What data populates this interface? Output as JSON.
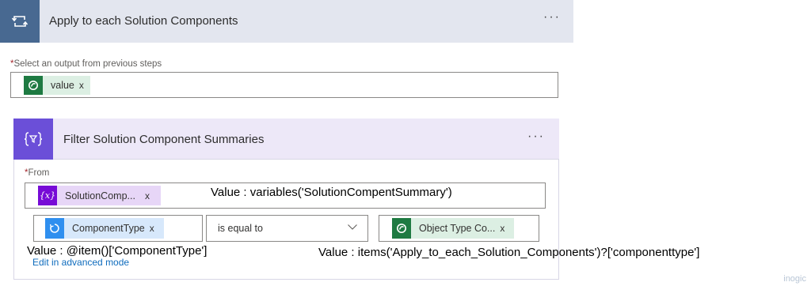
{
  "loop": {
    "title": "Apply to each Solution Components",
    "menu_dots": "···"
  },
  "output_select": {
    "required_mark": "*",
    "label": "Select an output from previous steps",
    "token": {
      "label": "value",
      "remove": "x",
      "icon": "dataverse-icon",
      "color": "#1e7a42"
    }
  },
  "filter": {
    "title": "Filter Solution Component Summaries",
    "menu_dots": "···",
    "from_required_mark": "*",
    "from_label": "From",
    "from_token": {
      "label": "SolutionComp...",
      "remove": "x",
      "icon": "variable-icon",
      "color": "#770bd6"
    },
    "condition": {
      "left_token": {
        "label": "ComponentType",
        "remove": "x",
        "icon": "loop-icon",
        "color": "#2f8fef"
      },
      "operator": "is equal to",
      "right_token": {
        "label": "Object Type Co...",
        "remove": "x",
        "icon": "dataverse-icon",
        "color": "#1e7a42"
      }
    },
    "advanced_link": "Edit in advanced mode"
  },
  "annotations": {
    "from_value": "Value : variables('SolutionCompentSummary')",
    "left_value": "Value : @item()['ComponentType']",
    "right_value": "Value : items('Apply_to_each_Solution_Components')?['componenttype']"
  },
  "watermark": "inogic"
}
